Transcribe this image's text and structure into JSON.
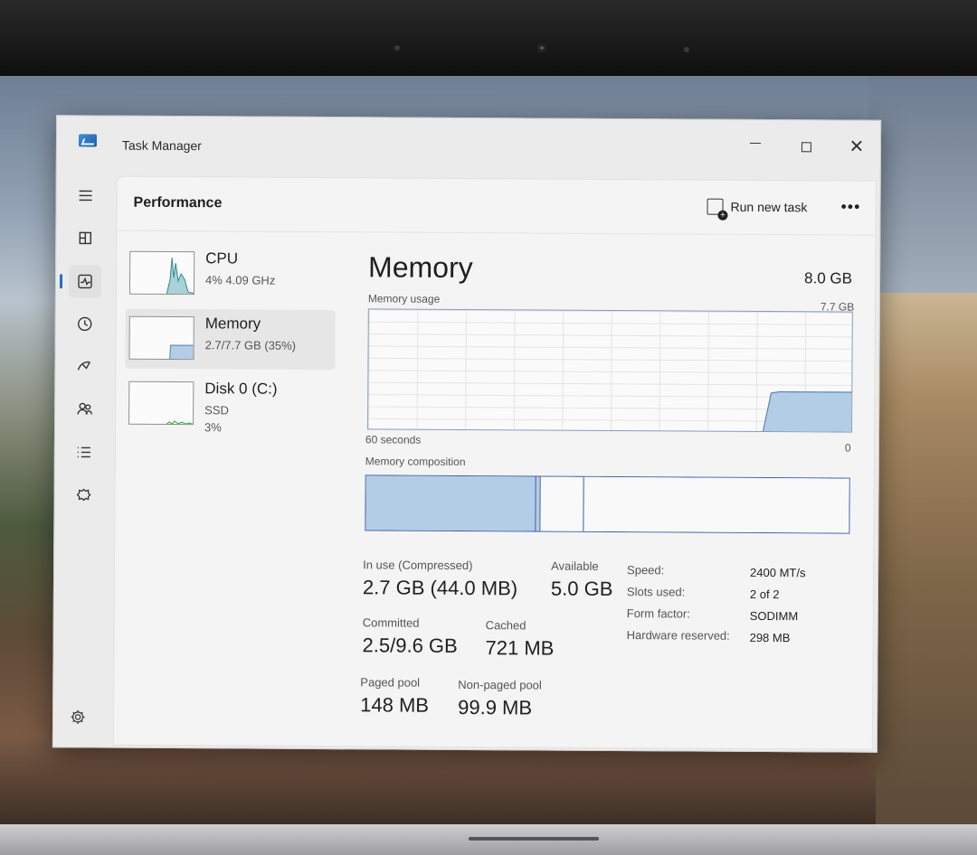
{
  "window": {
    "title": "Task Manager",
    "min_label": "—",
    "close_label": "✕"
  },
  "nav": {
    "items": [
      {
        "name": "menu-icon"
      },
      {
        "name": "processes-icon"
      },
      {
        "name": "performance-icon",
        "active": true
      },
      {
        "name": "app-history-icon"
      },
      {
        "name": "startup-apps-icon"
      },
      {
        "name": "users-icon"
      },
      {
        "name": "details-icon"
      },
      {
        "name": "services-icon"
      }
    ],
    "settings_icon": "gear-icon"
  },
  "header": {
    "title": "Performance",
    "run_new_task": "Run new task",
    "more": "•••"
  },
  "devices": [
    {
      "name": "CPU",
      "sub1": "4%  4.09 GHz",
      "sub2": "",
      "sub3": ""
    },
    {
      "name": "Memory",
      "sub1": "2.7/7.7 GB (35%)",
      "sub2": "",
      "sub3": "",
      "selected": true
    },
    {
      "name": "Disk 0 (C:)",
      "sub1": "SSD",
      "sub2": "3%",
      "sub3": ""
    }
  ],
  "memory": {
    "title": "Memory",
    "total": "8.0 GB",
    "usage_label": "Memory usage",
    "usage_max": "7.7 GB",
    "time_label": "60 seconds",
    "zero_label": "0",
    "composition_label": "Memory composition",
    "usage_history": [
      0,
      0,
      0,
      0,
      0,
      0,
      0,
      0,
      0,
      0,
      0,
      0,
      0,
      0,
      0,
      0,
      0,
      0,
      0,
      0,
      0,
      0,
      0,
      0,
      0,
      0,
      0,
      0,
      0,
      0,
      0,
      0,
      0,
      0,
      0,
      0,
      0,
      0,
      0,
      0,
      0,
      0,
      0,
      0,
      0,
      0,
      0,
      0,
      0,
      0.33,
      0.34,
      0.34,
      0.34,
      0.34,
      0.34,
      0.34,
      0.34,
      0.34,
      0.34,
      0.34
    ],
    "composition": [
      {
        "name": "in-use",
        "fraction": 0.35,
        "color": "#b4cde6"
      },
      {
        "name": "modified",
        "fraction": 0.01,
        "color": "#b4cde6"
      },
      {
        "name": "standby",
        "fraction": 0.09,
        "color": "#f9f9f9"
      },
      {
        "name": "free",
        "fraction": 0.55,
        "color": "#f9f9f9"
      }
    ],
    "stats": {
      "in_use_label": "In use (Compressed)",
      "in_use_value": "2.7 GB (44.0 MB)",
      "available_label": "Available",
      "available_value": "5.0 GB",
      "committed_label": "Committed",
      "committed_value": "2.5/9.6 GB",
      "cached_label": "Cached",
      "cached_value": "721 MB",
      "paged_label": "Paged pool",
      "paged_value": "148 MB",
      "nonpaged_label": "Non-paged pool",
      "nonpaged_value": "99.9 MB"
    },
    "details": [
      {
        "key": "Speed:",
        "value": "2400 MT/s"
      },
      {
        "key": "Slots used:",
        "value": "2 of 2"
      },
      {
        "key": "Form factor:",
        "value": "SODIMM"
      },
      {
        "key": "Hardware reserved:",
        "value": "298 MB"
      }
    ]
  },
  "colors": {
    "graph_fill": "#b4cde6",
    "graph_line": "#5b82b8",
    "cpu_fill": "#a9d2d6",
    "cpu_line": "#2f8a95",
    "disk_line": "#4caf50",
    "accent": "#2a6ac8"
  }
}
